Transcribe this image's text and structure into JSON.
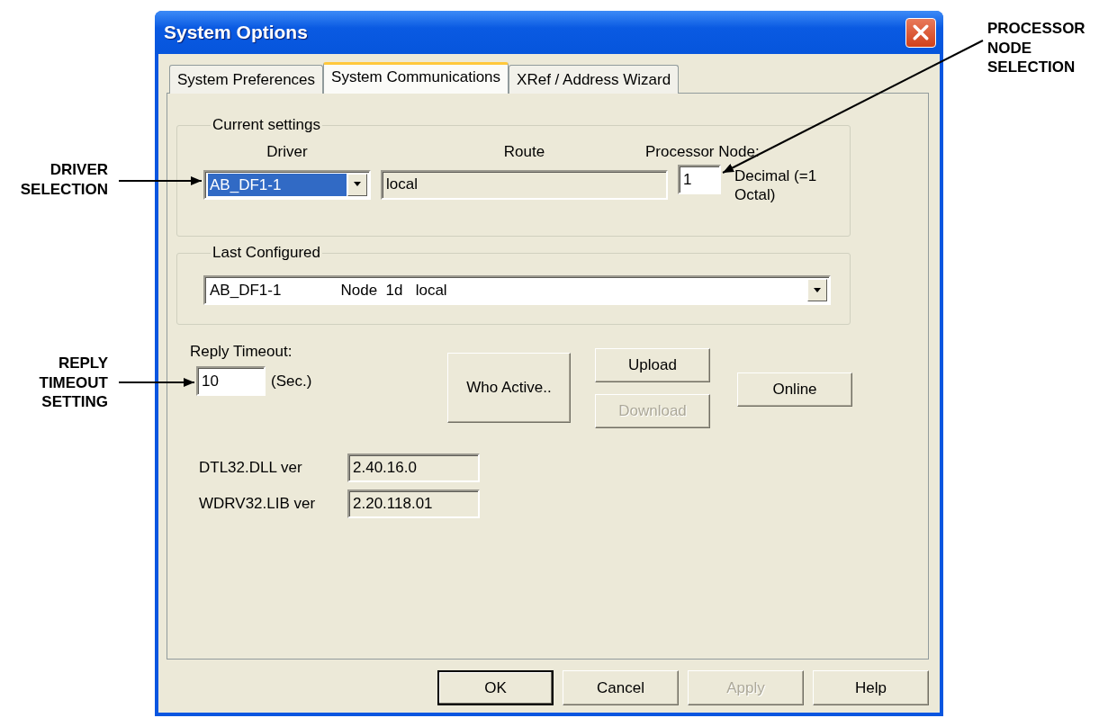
{
  "window": {
    "title": "System Options"
  },
  "tabs": [
    {
      "label": "System Preferences",
      "selected": false
    },
    {
      "label": "System Communications",
      "selected": true
    },
    {
      "label": "XRef / Address Wizard",
      "selected": false
    }
  ],
  "current_settings": {
    "title": "Current settings",
    "driver": {
      "label": "Driver",
      "value": "AB_DF1-1",
      "highlighted": true
    },
    "route": {
      "label": "Route",
      "value": "local"
    },
    "processor_node": {
      "label": "Processor Node:",
      "value": "1",
      "note": "Decimal (=1\nOctal)"
    }
  },
  "last_configured": {
    "title": "Last Configured",
    "value": "AB_DF1-1              Node  1d   local"
  },
  "reply_timeout": {
    "label": "Reply Timeout:",
    "value": "10",
    "unit": "(Sec.)"
  },
  "who_active_button": {
    "label": "Who Active..",
    "disabled": false
  },
  "upload_button": {
    "label": "Upload",
    "disabled": false
  },
  "download_button": {
    "label": "Download",
    "disabled": true
  },
  "online_button": {
    "label": "Online",
    "disabled": false
  },
  "versions": [
    {
      "label": "DTL32.DLL ver",
      "value": "2.40.16.0"
    },
    {
      "label": "WDRV32.LIB ver",
      "value": "2.20.118.01"
    }
  ],
  "dialog_buttons": [
    {
      "label": "OK",
      "default": true,
      "disabled": false
    },
    {
      "label": "Cancel",
      "default": false,
      "disabled": false
    },
    {
      "label": "Apply",
      "default": false,
      "disabled": true
    },
    {
      "label": "Help",
      "default": false,
      "disabled": false
    }
  ],
  "callouts": {
    "driver": "DRIVER\nSELECTION",
    "processor_node": "PROCESSOR\nNODE\nSELECTION",
    "reply_timeout": "REPLY\nTIMEOUT\nSETTING"
  }
}
